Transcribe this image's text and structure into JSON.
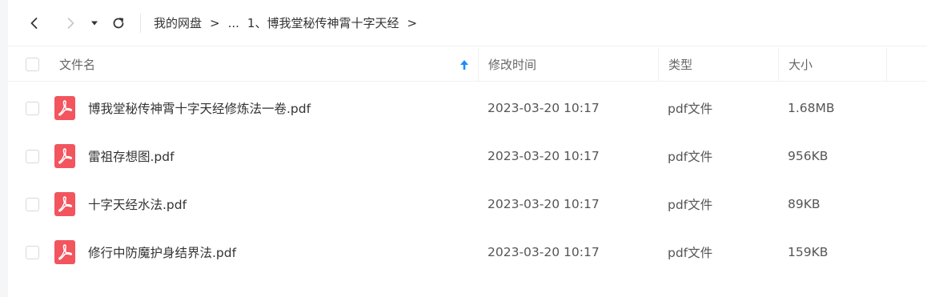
{
  "toolbar": {
    "back_icon": "chevron-left-icon",
    "forward_icon": "chevron-right-icon",
    "dropdown_icon": "caret-down-icon",
    "refresh_icon": "refresh-icon"
  },
  "breadcrumb": {
    "root": "我的网盘",
    "separator": ">",
    "ellipsis": "...",
    "current": "1、博我堂秘传神霄十字天经",
    "trailing_separator": ">"
  },
  "table": {
    "columns": {
      "name": "文件名",
      "time": "修改时间",
      "type": "类型",
      "size": "大小"
    },
    "sort": {
      "column": "name",
      "direction": "ascending",
      "icon": "arrow-up-icon",
      "color": "#1a8cff"
    },
    "rows": [
      {
        "name": "博我堂秘传神霄十字天经修炼法一卷.pdf",
        "time": "2023-03-20 10:17",
        "type": "pdf文件",
        "size": "1.68MB"
      },
      {
        "name": "雷祖存想图.pdf",
        "time": "2023-03-20 10:17",
        "type": "pdf文件",
        "size": "956KB"
      },
      {
        "name": "十字天经水法.pdf",
        "time": "2023-03-20 10:17",
        "type": "pdf文件",
        "size": "89KB"
      },
      {
        "name": "修行中防魔护身结界法.pdf",
        "time": "2023-03-20 10:17",
        "type": "pdf文件",
        "size": "159KB"
      }
    ]
  },
  "colors": {
    "pdf_icon": "#f2555e",
    "sort_arrow": "#1a8cff",
    "text": "#333333",
    "muted": "#666666"
  }
}
